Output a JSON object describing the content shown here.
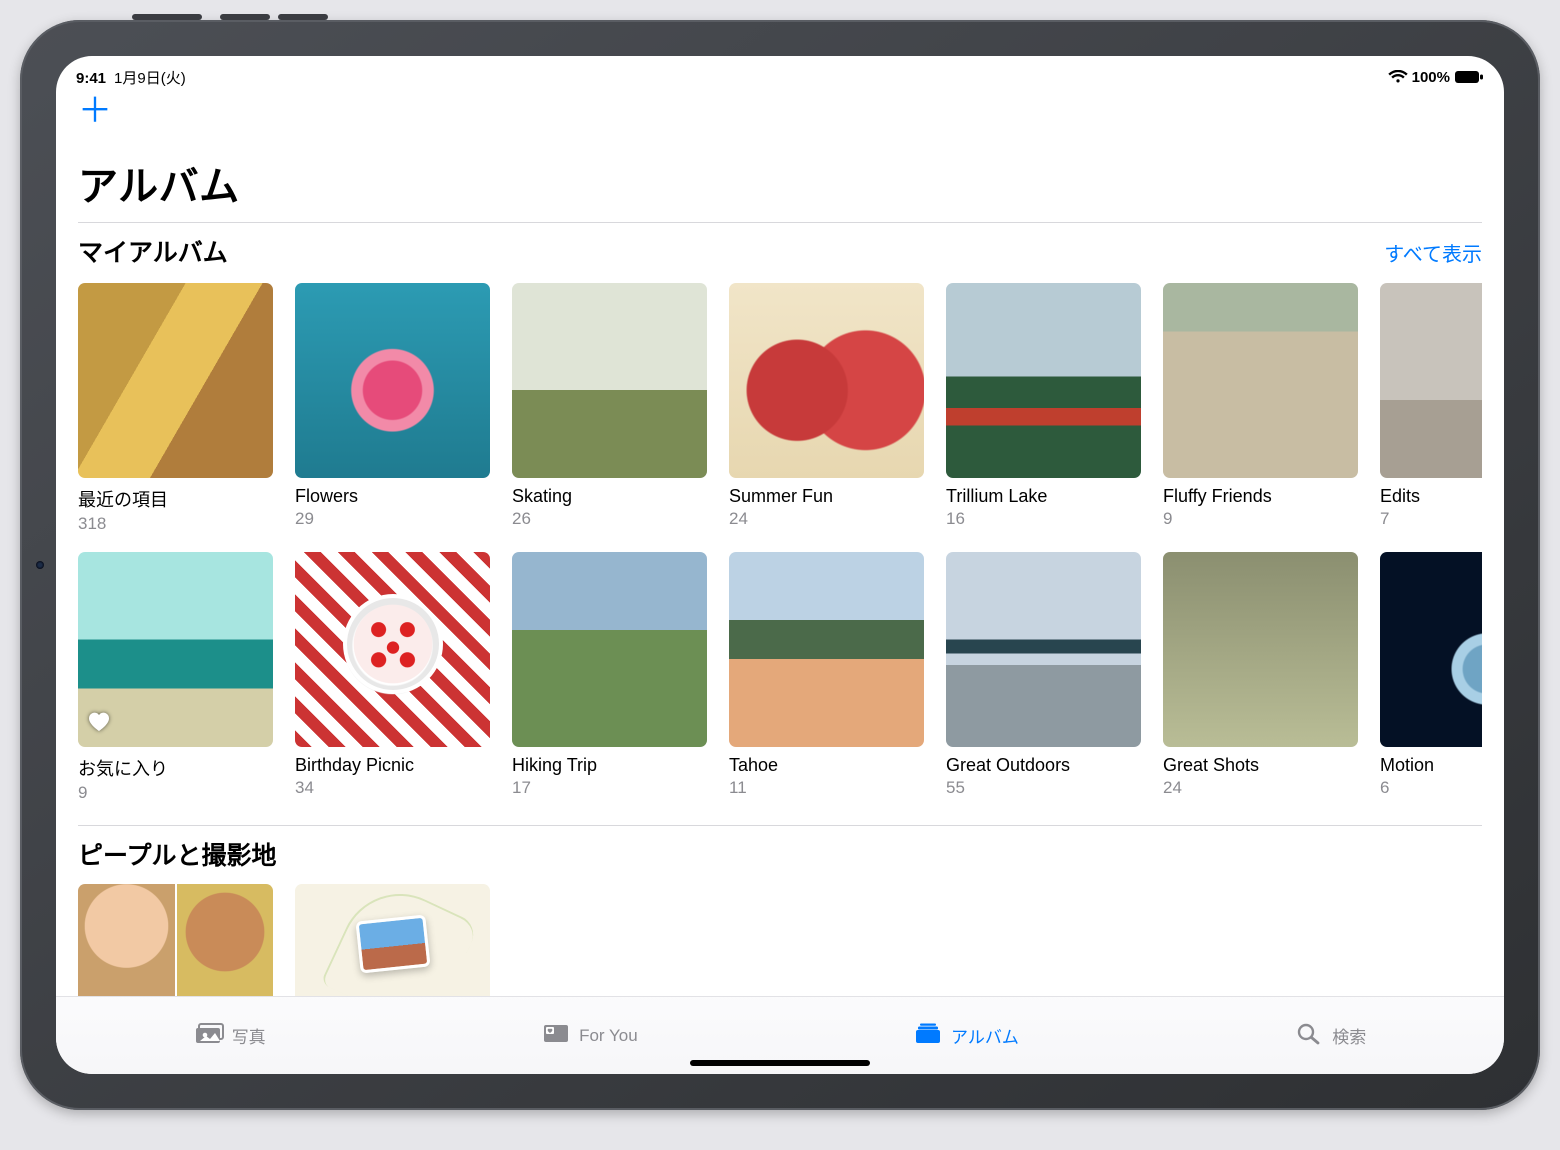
{
  "status": {
    "time": "9:41",
    "date": "1月9日(火)",
    "battery_pct": "100%"
  },
  "nav": {
    "title": "アルバム"
  },
  "sections": {
    "my_albums": {
      "heading": "マイアルバム",
      "see_all": "すべて表示",
      "row1": [
        {
          "title": "最近の項目",
          "count": "318"
        },
        {
          "title": "Flowers",
          "count": "29"
        },
        {
          "title": "Skating",
          "count": "26"
        },
        {
          "title": "Summer Fun",
          "count": "24"
        },
        {
          "title": "Trillium Lake",
          "count": "16"
        },
        {
          "title": "Fluffy Friends",
          "count": "9"
        },
        {
          "title": "Edits",
          "count": "7"
        }
      ],
      "row2": [
        {
          "title": "お気に入り",
          "count": "9"
        },
        {
          "title": "Birthday Picnic",
          "count": "34"
        },
        {
          "title": "Hiking Trip",
          "count": "17"
        },
        {
          "title": "Tahoe",
          "count": "11"
        },
        {
          "title": "Great Outdoors",
          "count": "55"
        },
        {
          "title": "Great Shots",
          "count": "24"
        },
        {
          "title": "Motion",
          "count": "6"
        }
      ]
    },
    "people_places": {
      "heading": "ピープルと撮影地"
    }
  },
  "tabs": {
    "photos": "写真",
    "for_you": "For You",
    "albums": "アルバム",
    "search": "検索"
  }
}
